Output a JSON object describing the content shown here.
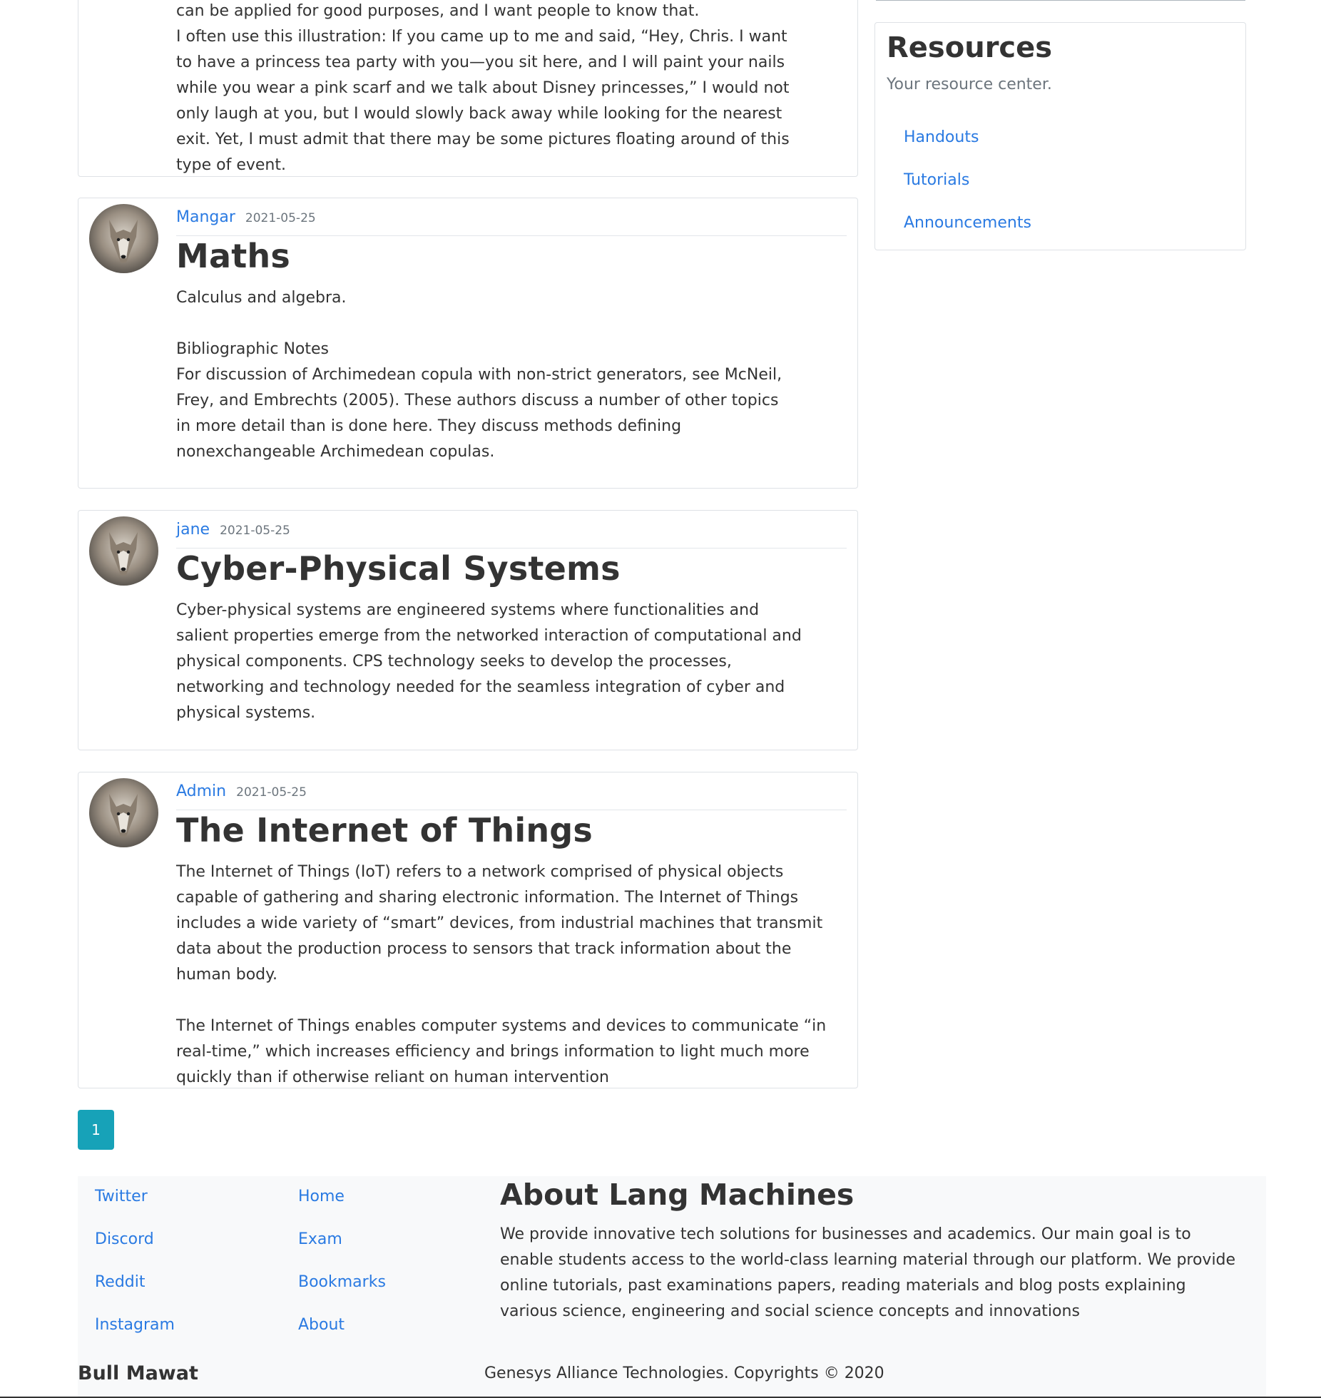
{
  "posts": [
    {
      "body": [
        "can be applied for good purposes, and I want people to know that.",
        "I often use this illustration: If you came up to me and said, “Hey, Chris. I want to have a princess tea party with you—you sit here, and I will paint your nails while you wear a pink scarf and we talk about Disney princesses,” I would not only laugh at you, but I would slowly back away while looking for the nearest exit. Yet, I must admit that there may be some pictures floating around of this type of event."
      ]
    },
    {
      "author": "Mangar",
      "date": "2021-05-25",
      "title": "Maths",
      "body": [
        "Calculus and algebra.",
        "Bibliographic Notes",
        "For discussion of Archimedean copula with non-strict generators, see McNeil, Frey, and Embrechts (2005). These authors discuss a number of other topics in more detail than is done here. They discuss methods defining nonexchangeable Archimedean copulas."
      ]
    },
    {
      "author": "jane",
      "date": "2021-05-25",
      "title": "Cyber-Physical Systems",
      "body": [
        "Cyber-physical systems are engineered systems where functionalities and salient properties emerge from the networked interaction of computational and physical components. CPS technology seeks to develop the processes, networking and technology needed for the seamless integration of cyber and physical systems."
      ]
    },
    {
      "author": "Admin",
      "date": "2021-05-25",
      "title": "The Internet of Things",
      "body": [
        "The Internet of Things (IoT) refers to a network comprised of physical objects capable of gathering and sharing electronic information. The Internet of Things includes a wide variety of “smart” devices, from industrial machines that transmit data about the production process to sensors that track information about the human body.",
        "The Internet of Things enables computer systems and devices to communicate “in real-time,” which increases efficiency and brings information to light much more quickly than if otherwise reliant on human intervention"
      ]
    }
  ],
  "sidebar": {
    "title": "Resources",
    "subtitle": "Your resource center.",
    "links": [
      "Handouts",
      "Tutorials",
      "Announcements"
    ]
  },
  "pagination": {
    "current": "1"
  },
  "footer": {
    "social": [
      "Twitter",
      "Discord",
      "Reddit",
      "Instagram"
    ],
    "nav": [
      "Home",
      "Exam",
      "Bookmarks",
      "About"
    ],
    "about_title": "About Lang Machines",
    "about_text": "We provide innovative tech solutions for businesses and academics. Our main goal is to enable students access to the world-class learning material through our platform. We provide online tutorials, past examinations papers, reading materials and blog posts explaining various science, engineering and social science concepts and innovations",
    "brand": "Bull Mawat",
    "copyright": "Genesys Alliance Technologies. Copyrights © 2020"
  },
  "colors": {
    "link": "#2a7ae2",
    "pager": "#17a2b8",
    "footer_bg": "#f8f9fa"
  },
  "icons": {
    "avatar": "wolf-avatar-icon"
  }
}
